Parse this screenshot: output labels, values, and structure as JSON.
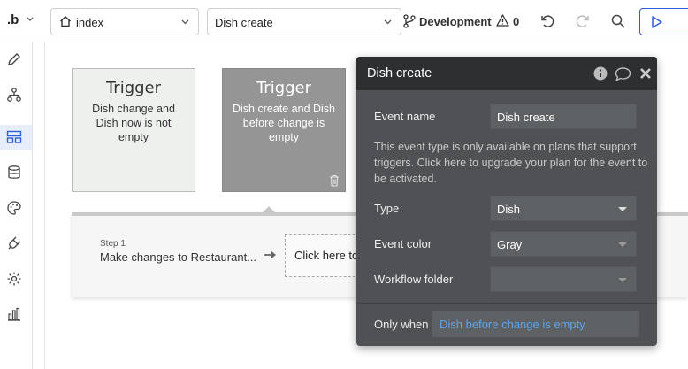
{
  "topbar": {
    "logo": ".b",
    "page_select": "index",
    "workflow_select": "Dish create",
    "environment": "Development",
    "warning_count": "0"
  },
  "canvas": {
    "trigger1": {
      "title": "Trigger",
      "description": "Dish change and Dish now is not empty"
    },
    "trigger2": {
      "title": "Trigger",
      "description": "Dish create and Dish before change is empty"
    },
    "step": {
      "number": "Step 1",
      "name": "Make changes to Restaurant..."
    },
    "click_here": "Click here to add an action..."
  },
  "panel": {
    "title": "Dish create",
    "event_name_label": "Event name",
    "event_name_value": "Dish create",
    "info": "This event type is only available on plans that support triggers. Click here to upgrade your plan for the event to be activated.",
    "type_label": "Type",
    "type_value": "Dish",
    "event_color_label": "Event color",
    "event_color_value": "Gray",
    "folder_label": "Workflow folder",
    "folder_value": "",
    "only_when_label": "Only when",
    "only_when_value": "Dish before change is empty"
  },
  "colors": {
    "accent": "#2f5fd6",
    "panel_bg": "#4f5154",
    "link": "#59a6ef"
  }
}
